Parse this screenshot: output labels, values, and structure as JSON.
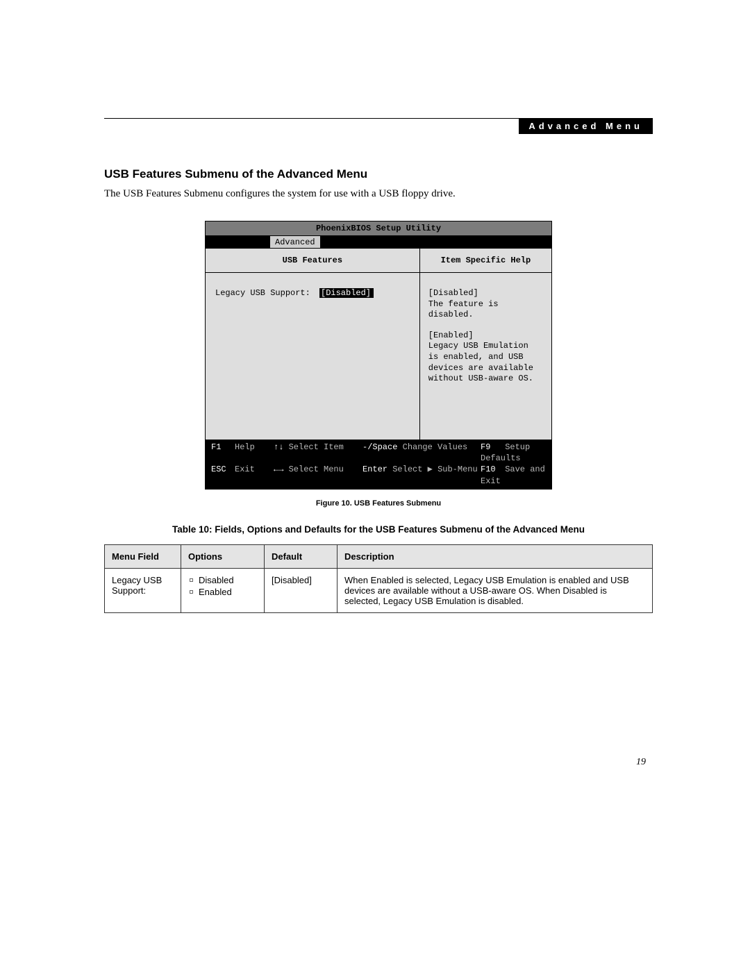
{
  "header": {
    "section": "Advanced Menu"
  },
  "title": "USB Features Submenu of the Advanced Menu",
  "intro": "The USB Features Submenu configures the system for use with a USB floppy drive.",
  "bios": {
    "title": "PhoenixBIOS Setup Utility",
    "tab": "Advanced",
    "left_header": "USB Features",
    "right_header": "Item Specific Help",
    "field_label": "Legacy USB Support:",
    "field_value": "[Disabled]",
    "help": {
      "disabled_label": "[Disabled]",
      "disabled_text": "The feature is disabled.",
      "enabled_label": "[Enabled]",
      "enabled_text": "Legacy USB Emulation is enabled, and USB devices are available without USB-aware OS."
    },
    "footer": {
      "f1": "F1",
      "f1_label": "Help",
      "esc": "ESC",
      "esc_label": "Exit",
      "updown": "↑↓",
      "updown_label": "Select Item",
      "leftright": "←→",
      "leftright_label": "Select Menu",
      "minus": "-/Space",
      "minus_label": "Change Values",
      "enter": "Enter",
      "enter_label_prefix": "Select ",
      "enter_label_suffix": " Sub-Menu",
      "f9": "F9",
      "f9_label": "Setup Defaults",
      "f10": "F10",
      "f10_label": "Save and Exit"
    }
  },
  "figure_caption": "Figure 10.  USB Features Submenu",
  "table_caption": "Table 10: Fields, Options and Defaults for the USB Features Submenu of the Advanced Menu",
  "table": {
    "headers": {
      "menu": "Menu Field",
      "options": "Options",
      "default": "Default",
      "desc": "Description"
    },
    "row": {
      "menu": "Legacy USB Support:",
      "opt1": "Disabled",
      "opt2": "Enabled",
      "default": "[Disabled]",
      "desc": "When Enabled is selected, Legacy USB Emulation is enabled and USB devices are available without a USB-aware OS. When Disabled is selected, Legacy USB Emulation is disabled."
    }
  },
  "page_number": "19"
}
